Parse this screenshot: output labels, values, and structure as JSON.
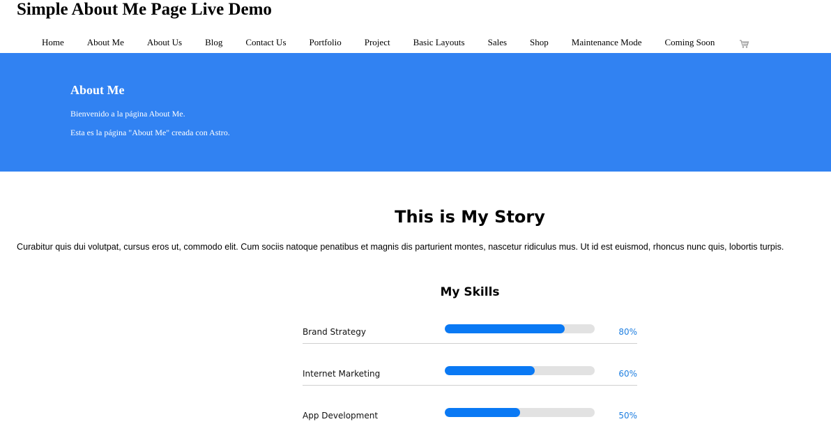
{
  "header": {
    "title": "Simple About Me Page Live Demo"
  },
  "nav": {
    "items": [
      {
        "label": "Home",
        "name": "nav-home"
      },
      {
        "label": "About Me",
        "name": "nav-about-me"
      },
      {
        "label": "About Us",
        "name": "nav-about-us"
      },
      {
        "label": "Blog",
        "name": "nav-blog"
      },
      {
        "label": "Contact Us",
        "name": "nav-contact-us"
      },
      {
        "label": "Portfolio",
        "name": "nav-portfolio"
      },
      {
        "label": "Project",
        "name": "nav-project"
      },
      {
        "label": "Basic Layouts",
        "name": "nav-basic-layouts"
      },
      {
        "label": "Sales",
        "name": "nav-sales"
      },
      {
        "label": "Shop",
        "name": "nav-shop"
      },
      {
        "label": "Maintenance Mode",
        "name": "nav-maintenance-mode"
      },
      {
        "label": "Coming Soon",
        "name": "nav-coming-soon"
      }
    ],
    "cart_icon": "cart-icon"
  },
  "hero": {
    "title": "About Me",
    "line1": "Bienvenido a la página About Me.",
    "line2": "Esta es la página \"About Me\" creada con Astro.",
    "background": "#3182f2"
  },
  "story": {
    "title": "This is My Story",
    "text": "Curabitur quis dui volutpat, cursus eros ut, commodo elit. Cum sociis natoque penatibus et magnis dis parturient montes, nascetur ridiculus mus. Ut id est euismod, rhoncus nunc quis, lobortis turpis."
  },
  "skills": {
    "title": "My Skills",
    "accent": "#0a79f4",
    "items": [
      {
        "name": "Brand Strategy",
        "percent_label": "80%",
        "level": 0.8
      },
      {
        "name": "Internet Marketing",
        "percent_label": "60%",
        "level": 0.6
      },
      {
        "name": "App Development",
        "percent_label": "50%",
        "level": 0.5
      }
    ]
  }
}
